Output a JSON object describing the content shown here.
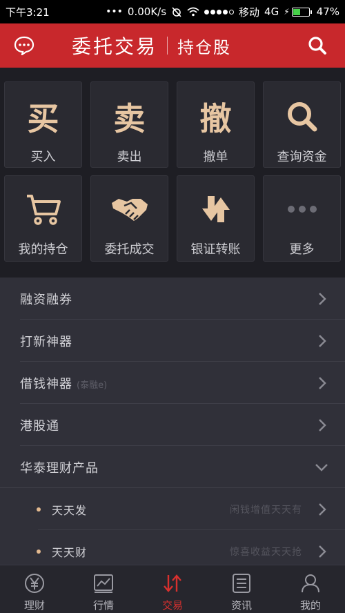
{
  "status_bar": {
    "time": "下午3:21",
    "speed": "0.00K/s",
    "carrier": "移动",
    "network": "4G",
    "battery": "47%",
    "battery_level": 0.47
  },
  "header": {
    "title": "委托交易",
    "subtitle": "持仓股"
  },
  "grid": [
    {
      "label": "买入",
      "glyph": "买",
      "icon": "buy-glyph"
    },
    {
      "label": "卖出",
      "glyph": "卖",
      "icon": "sell-glyph"
    },
    {
      "label": "撤单",
      "glyph": "撤",
      "icon": "cancel-glyph"
    },
    {
      "label": "查询资金",
      "icon": "search-icon"
    },
    {
      "label": "我的持仓",
      "icon": "cart-icon"
    },
    {
      "label": "委托成交",
      "icon": "handshake-icon"
    },
    {
      "label": "银证转账",
      "icon": "transfer-arrows-icon"
    },
    {
      "label": "更多",
      "icon": "more-dots-icon"
    }
  ],
  "list": [
    {
      "label": "融资融券",
      "hint": ""
    },
    {
      "label": "打新神器",
      "hint": ""
    },
    {
      "label": "借钱神器",
      "hint": "(泰融e)"
    },
    {
      "label": "港股通",
      "hint": ""
    },
    {
      "label": "华泰理财产品",
      "hint": "",
      "expanded": true
    }
  ],
  "sub_list": [
    {
      "label": "天天发",
      "desc": "闲钱增值天天有"
    },
    {
      "label": "天天财",
      "desc": "惊喜收益天天抢"
    }
  ],
  "tabs": [
    {
      "label": "理财",
      "icon": "yen-coin-icon"
    },
    {
      "label": "行情",
      "icon": "chart-icon"
    },
    {
      "label": "交易",
      "icon": "trade-arrows-icon",
      "active": true
    },
    {
      "label": "资讯",
      "icon": "news-list-icon"
    },
    {
      "label": "我的",
      "icon": "user-icon"
    }
  ],
  "colors": {
    "brand_red": "#c8282c",
    "accent_gold": "#e7c6a2",
    "active_tab": "#d8302e"
  }
}
